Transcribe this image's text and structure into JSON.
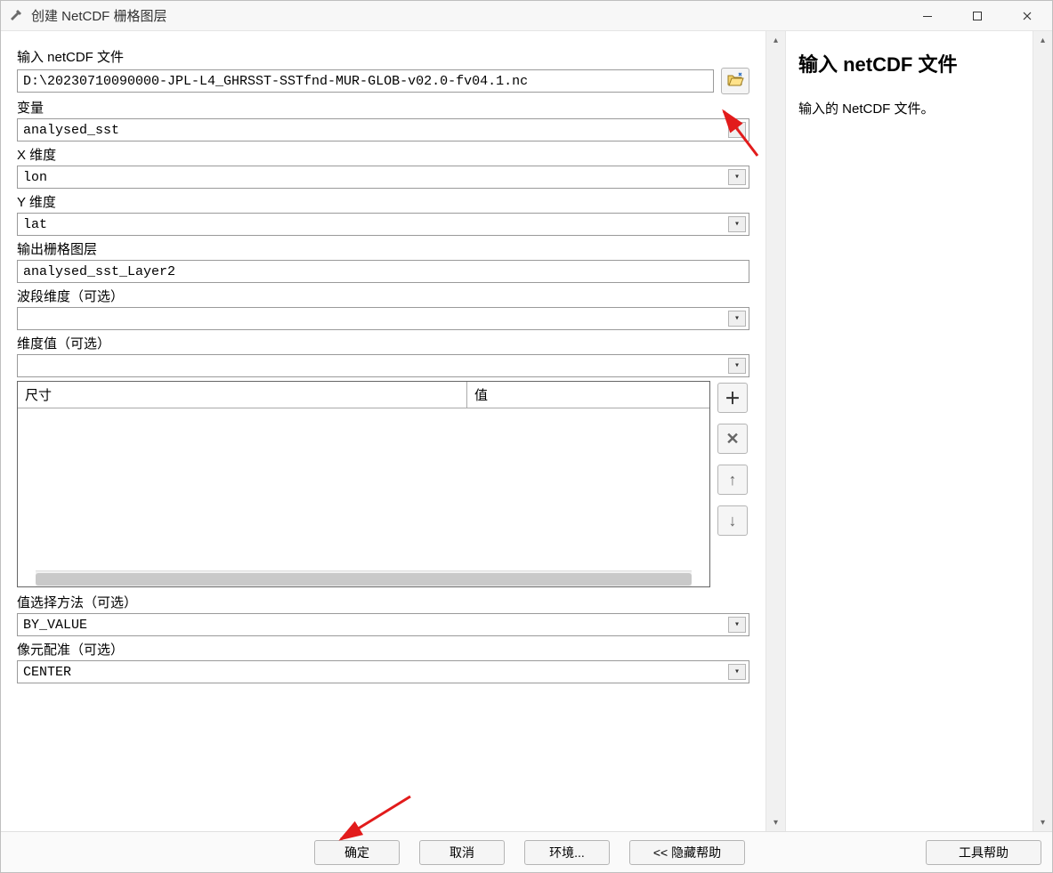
{
  "window": {
    "title": "创建 NetCDF 栅格图层"
  },
  "form": {
    "input_netcdf_label": "输入 netCDF 文件",
    "input_netcdf_value": "D:\\20230710090000-JPL-L4_GHRSST-SSTfnd-MUR-GLOB-v02.0-fv04.1.nc",
    "variable_label": "变量",
    "variable_value": "analysed_sst",
    "xdim_label": "X 维度",
    "xdim_value": "lon",
    "ydim_label": "Y 维度",
    "ydim_value": "lat",
    "output_layer_label": "输出栅格图层",
    "output_layer_value": "analysed_sst_Layer2",
    "band_dim_label": "波段维度（可选）",
    "band_dim_value": "",
    "dim_values_label": "维度值（可选）",
    "dim_values_value": "",
    "table": {
      "col1": "尺寸",
      "col2": "值"
    },
    "value_select_label": "值选择方法（可选）",
    "value_select_value": "BY_VALUE",
    "cell_reg_label": "像元配准（可选）",
    "cell_reg_value": "CENTER"
  },
  "help": {
    "title": "输入 netCDF 文件",
    "body": "输入的 NetCDF 文件。"
  },
  "footer": {
    "ok": "确定",
    "cancel": "取消",
    "env": "环境...",
    "hide_help": "<< 隐藏帮助",
    "tool_help": "工具帮助"
  }
}
